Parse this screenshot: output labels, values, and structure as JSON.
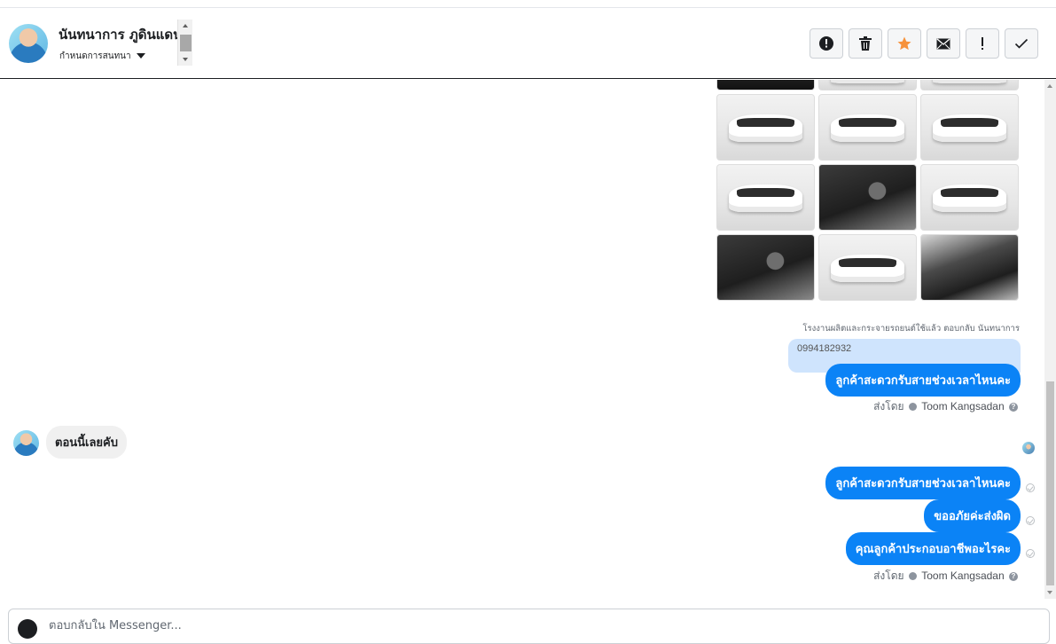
{
  "header": {
    "contact_name": "นันทนาการ ภูดินแดน",
    "conversation_setting": "กำหนดการสนทนา",
    "toolbar": [
      {
        "name": "spam-report-button",
        "icon": "alert-circle-icon",
        "color": "#1c1e21"
      },
      {
        "name": "delete-button",
        "icon": "trash-icon",
        "color": "#1c1e21"
      },
      {
        "name": "star-button",
        "icon": "star-icon",
        "color": "#f7923b"
      },
      {
        "name": "mark-unread-button",
        "icon": "envelope-icon",
        "color": "#1c1e21"
      },
      {
        "name": "follow-up-button",
        "icon": "exclamation-icon",
        "color": "#1c1e21"
      },
      {
        "name": "mark-done-button",
        "icon": "checkmark-icon",
        "color": "#1c1e21"
      }
    ]
  },
  "thread": {
    "photo_caption": "โรงงานผลิตและกระจายรถยนต์ใช้แล้ว ตอบกลับ นันทนาการ",
    "phone_text": "0994182932",
    "outgoing_1": "ลูกค้าสะดวกรับสายช่วงเวลาไหนคะ",
    "sent_by_label": "ส่งโดย",
    "sender_name": "Toom Kangsadan",
    "incoming_1": "ตอนนี้เลยคับ",
    "outgoing_2": "ลูกค้าสะดวกรับสายช่วงเวลาไหนคะ",
    "outgoing_3": "ขออภัยค่ะส่งผิด",
    "outgoing_4": "คุณลูกค้าประกอบอาชีพอะไรคะ",
    "sent_by_label_2": "ส่งโดย",
    "sender_name_2": "Toom Kangsadan"
  },
  "composer": {
    "placeholder": "ตอบกลับใน Messenger..."
  },
  "colors": {
    "accent_blue": "#0b83f6",
    "light_blue": "#cfe4fd",
    "incoming_gray": "#f0f0f0"
  }
}
